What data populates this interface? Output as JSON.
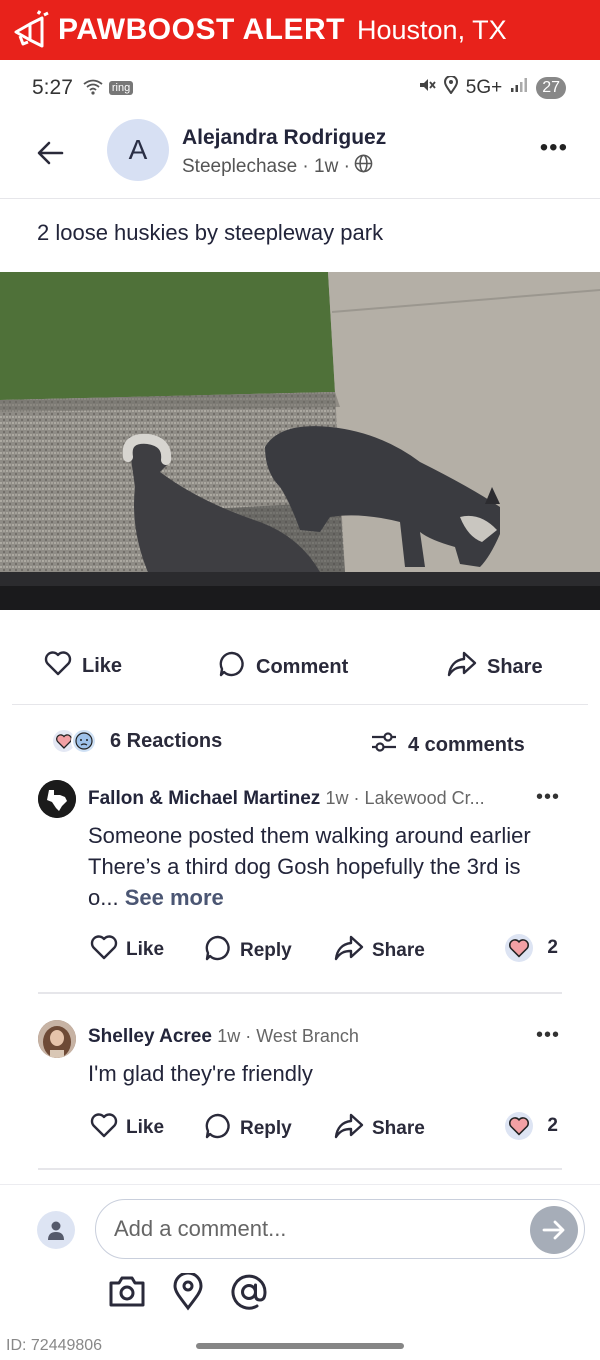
{
  "banner": {
    "brand": "PAWBOOST ALERT",
    "location": "Houston, TX",
    "color": "#e8221b"
  },
  "status_bar": {
    "time": "5:27",
    "ring_label": "ring",
    "network": "5G+",
    "battery": "27"
  },
  "post": {
    "author_initial": "A",
    "author": "Alejandra Rodriguez",
    "meta": "Steeplechase · 1w ·",
    "text": "2 loose huskies by steepleway park"
  },
  "actions": {
    "like": "Like",
    "comment": "Comment",
    "share": "Share"
  },
  "summary": {
    "reactions": "6 Reactions",
    "comments": "4 comments"
  },
  "comments": [
    {
      "name": "Fallon & Michael Martinez",
      "meta": "1w · Lakewood Cr...",
      "body": "Someone posted them walking around earlier  There’s a third dog  Gosh hopefully the 3rd is o...",
      "see_more": "See more",
      "like": "Like",
      "reply": "Reply",
      "share": "Share",
      "reaction_count": "2"
    },
    {
      "name": "Shelley Acree",
      "meta": "1w · West Branch",
      "body": "I'm glad they're friendly",
      "like": "Like",
      "reply": "Reply",
      "share": "Share",
      "reaction_count": "2"
    }
  ],
  "composer": {
    "placeholder": "Add a comment..."
  },
  "footer": {
    "id": "ID: 72449806"
  }
}
